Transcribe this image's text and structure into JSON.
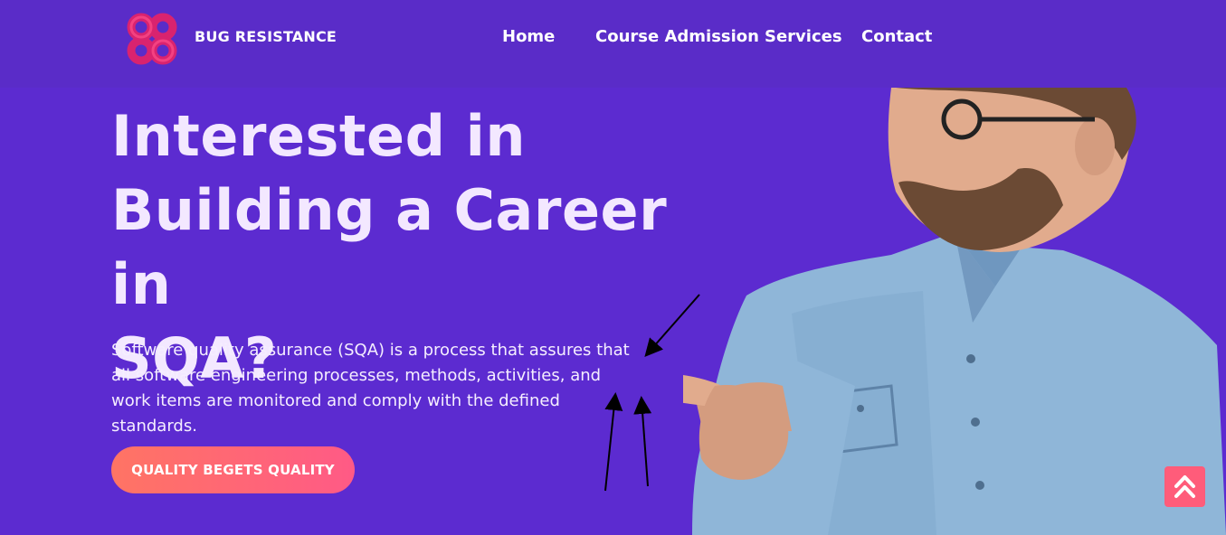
{
  "brand": {
    "name": "BUG RESISTANCE",
    "logo_icon": "interlocked-rings-logo-icon",
    "logo_colors": [
      "#d9236f",
      "#ff4f8b"
    ]
  },
  "nav": {
    "items": [
      {
        "label": "Home"
      },
      {
        "label": "Course Admission"
      },
      {
        "label": "Services"
      },
      {
        "label": "Contact"
      }
    ]
  },
  "hero": {
    "title_lines": [
      "Interested in",
      "Building a Career in",
      "SQA?"
    ],
    "description": "Software quality assurance (SQA) is a process that assures that all software engineering processes, methods, activities, and work items are monitored and comply with the defined standards.",
    "cta_label": "QUALITY BEGETS QUALITY",
    "photo_icon": "man-pointing-illustration"
  },
  "scroll_top": {
    "icon": "double-chevron-up-icon"
  },
  "colors": {
    "background": "#5c2bd0",
    "navbar": "#5a2cc8",
    "title_text": "#f3e8ff",
    "cta_gradient_start": "#ff7464",
    "cta_gradient_end": "#ff5a86",
    "scroll_top": "#ff5c7a"
  }
}
